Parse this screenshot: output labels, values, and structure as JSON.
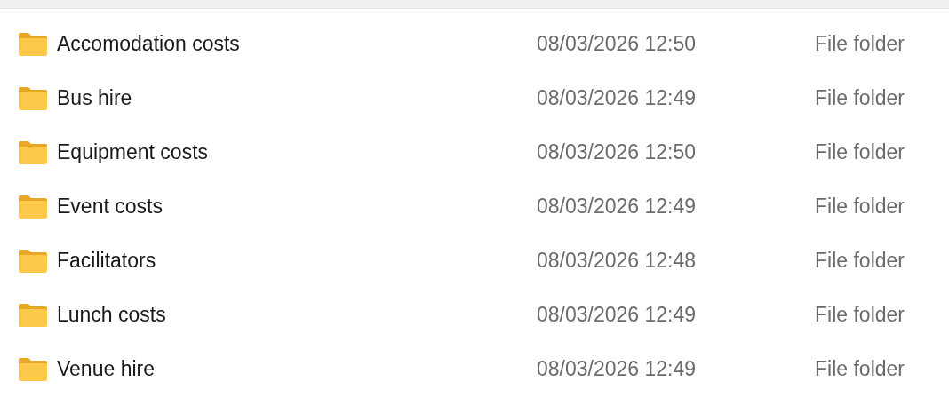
{
  "files": [
    {
      "name": "Accomodation costs",
      "date_modified": "08/03/2026 12:50",
      "type": "File folder"
    },
    {
      "name": "Bus hire",
      "date_modified": "08/03/2026 12:49",
      "type": "File folder"
    },
    {
      "name": "Equipment costs",
      "date_modified": "08/03/2026 12:50",
      "type": "File folder"
    },
    {
      "name": "Event costs",
      "date_modified": "08/03/2026 12:49",
      "type": "File folder"
    },
    {
      "name": "Facilitators",
      "date_modified": "08/03/2026 12:48",
      "type": "File folder"
    },
    {
      "name": "Lunch costs",
      "date_modified": "08/03/2026 12:49",
      "type": "File folder"
    },
    {
      "name": "Venue hire",
      "date_modified": "08/03/2026 12:49",
      "type": "File folder"
    }
  ]
}
